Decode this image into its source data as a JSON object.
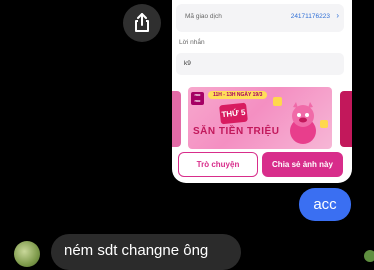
{
  "receipt": {
    "tx_label": "Mã giao dịch",
    "tx_value": "24171176223",
    "note_label": "Lời nhắn",
    "note_value": "k9",
    "banner": {
      "logo": "mo mo",
      "date_text": "11H - 13H NGÀY 19/3",
      "day_text": "THỨ 5",
      "headline": "SĂN TIỀN TRIỆU"
    },
    "chat_button": "Trò chuyện",
    "share_button": "Chia sẻ ảnh này"
  },
  "messages": {
    "outgoing": "acc",
    "incoming": "ném sdt changne ông"
  },
  "icons": {
    "share": "share-icon",
    "chevron": "chevron-right-icon"
  },
  "colors": {
    "brand_pink": "#d82d8b",
    "outgoing_bubble": "#3a6ff2",
    "incoming_bubble": "#2b2b2b"
  }
}
